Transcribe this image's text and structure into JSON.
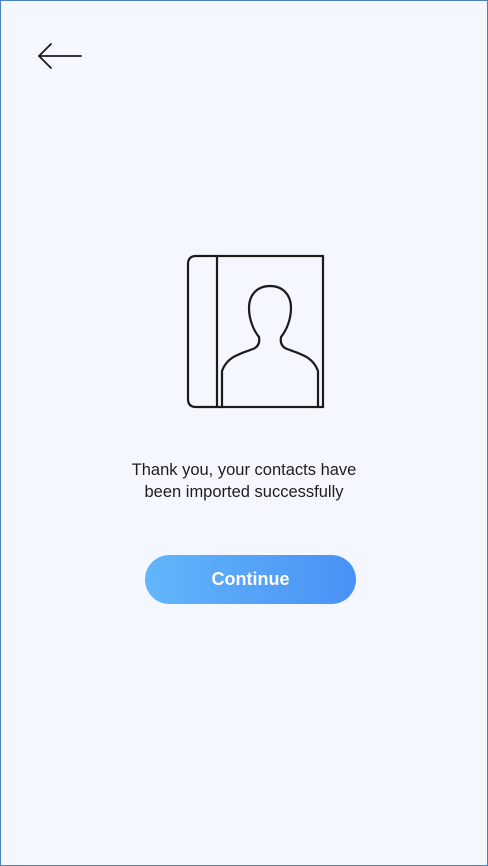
{
  "header": {
    "back_icon": "arrow-left-icon"
  },
  "illustration": {
    "icon": "contact-book-icon"
  },
  "message": {
    "line1": "Thank you, your contacts have",
    "line2": "been imported successfully"
  },
  "actions": {
    "continue_label": "Continue"
  },
  "colors": {
    "background": "#f4f7fe",
    "frame_border": "#4a7fc0",
    "button_gradient_start": "#62b6fb",
    "button_gradient_end": "#4a91f5",
    "text": "#1e1e1e",
    "icon_stroke": "#1b1b1b"
  }
}
